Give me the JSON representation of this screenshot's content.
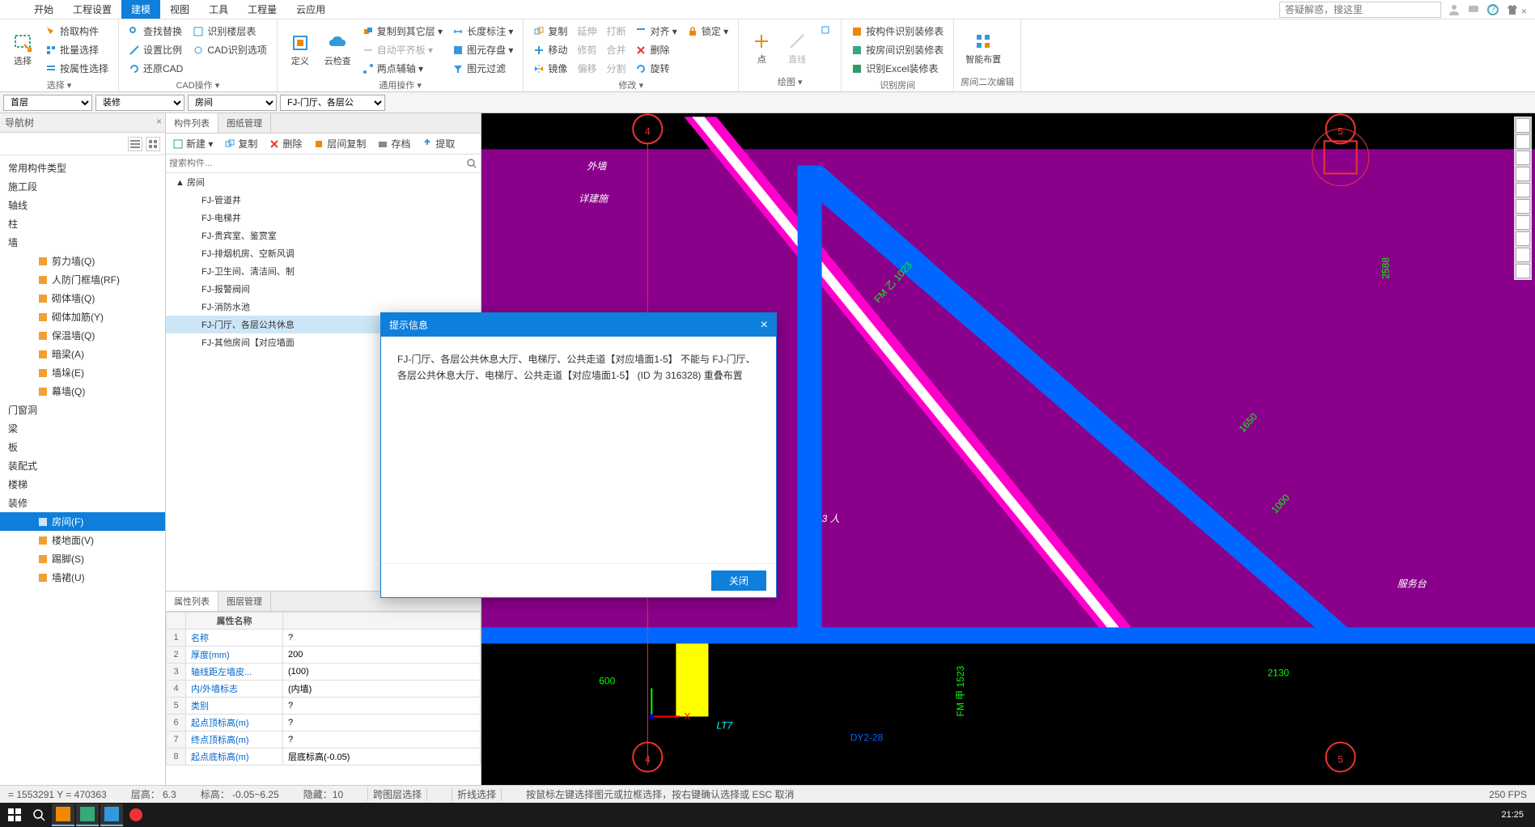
{
  "menubar": {
    "items": [
      "开始",
      "工程设置",
      "建模",
      "视图",
      "工具",
      "工程量",
      "云应用"
    ],
    "active_index": 2,
    "search_placeholder": "答疑解惑，搜这里"
  },
  "ribbon": {
    "groups": [
      {
        "label": "选择 ▾",
        "big": [
          {
            "name": "选择"
          }
        ],
        "cols": [
          [
            {
              "label": "拾取构件"
            },
            {
              "label": "批量选择"
            },
            {
              "label": "按属性选择"
            }
          ]
        ]
      },
      {
        "label": "CAD操作 ▾",
        "cols": [
          [
            {
              "label": "查找替换"
            },
            {
              "label": "设置比例"
            },
            {
              "label": "还原CAD"
            }
          ],
          [
            {
              "label": "识别楼层表"
            },
            {
              "label": "CAD识别选项"
            },
            {
              "label": ""
            }
          ]
        ]
      },
      {
        "label": "通用操作 ▾",
        "big": [
          {
            "name": "定义"
          },
          {
            "name": "云检查"
          }
        ],
        "cols": [
          [
            {
              "label": "复制到其它层 ▾"
            },
            {
              "label": "自动平齐板 ▾",
              "disabled": true
            },
            {
              "label": "两点辅轴 ▾"
            }
          ],
          [
            {
              "label": "长度标注 ▾"
            },
            {
              "label": "图元存盘 ▾"
            },
            {
              "label": "图元过滤"
            }
          ]
        ]
      },
      {
        "label": "修改 ▾",
        "cols": [
          [
            {
              "label": "复制"
            },
            {
              "label": "移动"
            },
            {
              "label": "镜像"
            }
          ],
          [
            {
              "label": "延伸",
              "disabled": true
            },
            {
              "label": "修剪",
              "disabled": true
            },
            {
              "label": "偏移",
              "disabled": true
            }
          ],
          [
            {
              "label": "打断",
              "disabled": true
            },
            {
              "label": "合并",
              "disabled": true
            },
            {
              "label": "分割",
              "disabled": true
            }
          ],
          [
            {
              "label": "对齐 ▾"
            },
            {
              "label": "删除"
            },
            {
              "label": "旋转"
            }
          ],
          [
            {
              "label": "锁定 ▾"
            }
          ]
        ]
      },
      {
        "label": "绘图 ▾",
        "big": [
          {
            "name": "点"
          },
          {
            "name": "直线",
            "disabled": true
          }
        ],
        "cols": [
          [
            {
              "label": ""
            }
          ]
        ]
      },
      {
        "label": "识别房间",
        "cols": [
          [
            {
              "label": "按构件识别装修表"
            },
            {
              "label": "按房间识别装修表"
            },
            {
              "label": "识别Excel装修表"
            }
          ]
        ]
      },
      {
        "label": "房间二次编辑",
        "big": [
          {
            "name": "智能布置"
          }
        ]
      }
    ]
  },
  "context_bar": {
    "floor": "首层",
    "category": "装修",
    "type": "房间",
    "component": "FJ-门厅、各层公"
  },
  "nav_panel": {
    "title": "导航树",
    "items": [
      {
        "label": "常用构件类型",
        "level": 0
      },
      {
        "label": "施工段",
        "level": 0
      },
      {
        "label": "轴线",
        "level": 0
      },
      {
        "label": "柱",
        "level": 0
      },
      {
        "label": "墙",
        "level": 0
      },
      {
        "label": "剪力墙(Q)",
        "level": 2,
        "icon": "wall"
      },
      {
        "label": "人防门框墙(RF)",
        "level": 2,
        "icon": "wall"
      },
      {
        "label": "砌体墙(Q)",
        "level": 2,
        "icon": "wall"
      },
      {
        "label": "砌体加筋(Y)",
        "level": 2,
        "icon": "rebar"
      },
      {
        "label": "保温墙(Q)",
        "level": 2,
        "icon": "wall"
      },
      {
        "label": "暗梁(A)",
        "level": 2,
        "icon": "beam"
      },
      {
        "label": "墙垛(E)",
        "level": 2,
        "icon": "wall"
      },
      {
        "label": "幕墙(Q)",
        "level": 2,
        "icon": "wall"
      },
      {
        "label": "门窗洞",
        "level": 0
      },
      {
        "label": "梁",
        "level": 0
      },
      {
        "label": "板",
        "level": 0
      },
      {
        "label": "装配式",
        "level": 0
      },
      {
        "label": "楼梯",
        "level": 0
      },
      {
        "label": "装修",
        "level": 0
      },
      {
        "label": "房间(F)",
        "level": 2,
        "selected": true,
        "icon": "room"
      },
      {
        "label": "楼地面(V)",
        "level": 2,
        "icon": "floor"
      },
      {
        "label": "踢脚(S)",
        "level": 2,
        "icon": "skirting"
      },
      {
        "label": "墙裙(U)",
        "level": 2,
        "icon": "wainscot"
      }
    ]
  },
  "comp_panel": {
    "tabs": [
      "构件列表",
      "图纸管理"
    ],
    "active_tab": 0,
    "toolbar": [
      "新建 ▾",
      "复制",
      "删除",
      "层间复制",
      "存档",
      "提取"
    ],
    "search_placeholder": "搜索构件...",
    "tree": [
      {
        "label": "▲ 房间",
        "parent": true
      },
      {
        "label": "FJ-管道井"
      },
      {
        "label": "FJ-电梯井"
      },
      {
        "label": "FJ-贵宾室、鉴赏室"
      },
      {
        "label": "FJ-排烟机房、空新风调"
      },
      {
        "label": "FJ-卫生间、清洁间、制"
      },
      {
        "label": "FJ-报警阀间"
      },
      {
        "label": "FJ-消防水池"
      },
      {
        "label": "FJ-门厅、各层公共休息",
        "selected": true
      },
      {
        "label": "FJ-其他房间【对应墙面"
      }
    ]
  },
  "prop_panel": {
    "tabs": [
      "属性列表",
      "图层管理"
    ],
    "active_tab": 0,
    "headers": [
      "",
      "属性名称",
      ""
    ],
    "rows": [
      {
        "n": 1,
        "name": "名称",
        "value": "?"
      },
      {
        "n": 2,
        "name": "厚度(mm)",
        "value": "200"
      },
      {
        "n": 3,
        "name": "轴线距左墙皮...",
        "value": "(100)"
      },
      {
        "n": 4,
        "name": "内/外墙标志",
        "value": "(内墙)"
      },
      {
        "n": 5,
        "name": "类别",
        "value": "?"
      },
      {
        "n": 6,
        "name": "起点顶标高(m)",
        "value": "?"
      },
      {
        "n": 7,
        "name": "终点顶标高(m)",
        "value": "?"
      },
      {
        "n": 8,
        "name": "起点底标高(m)",
        "value": "层底标高(-0.05)"
      }
    ]
  },
  "canvas": {
    "annotations": {
      "axis_4": "4",
      "axis_5": "5",
      "waiqiang": "外墙",
      "xiangjianshi": "详建施",
      "fuwu": "服务台",
      "lt7": "LT7",
      "dy2": "DY2-28",
      "dim_2588": "2588",
      "dim_1650": "1650",
      "dim_1000": "1000",
      "dim_600": "600",
      "dim_2130": "2130",
      "fm1523": "FM 甲 1523",
      "fm1023": "FM 乙 1023",
      "sanren": "3 人"
    }
  },
  "dialog": {
    "title": "提示信息",
    "body": "FJ-门厅、各层公共休息大厅、电梯厅、公共走道【对应墙面1-5】 不能与 FJ-门厅、各层公共休息大厅、电梯厅、公共走道【对应墙面1-5】  (ID 为 316328)  重叠布置",
    "close_btn": "关闭"
  },
  "statusbar": {
    "coords": "= 1553291 Y = 470363",
    "floor_height": "层高：  6.3",
    "elevation": "标高：  -0.05~6.25",
    "hidden": "隐藏：10",
    "cross_floor": "跨图层选择",
    "polyline": "折线选择",
    "hint": "按鼠标左键选择图元或拉框选择，按右键确认选择或 ESC 取消",
    "fps": "250 FPS"
  },
  "taskbar": {
    "time": "21:25"
  }
}
